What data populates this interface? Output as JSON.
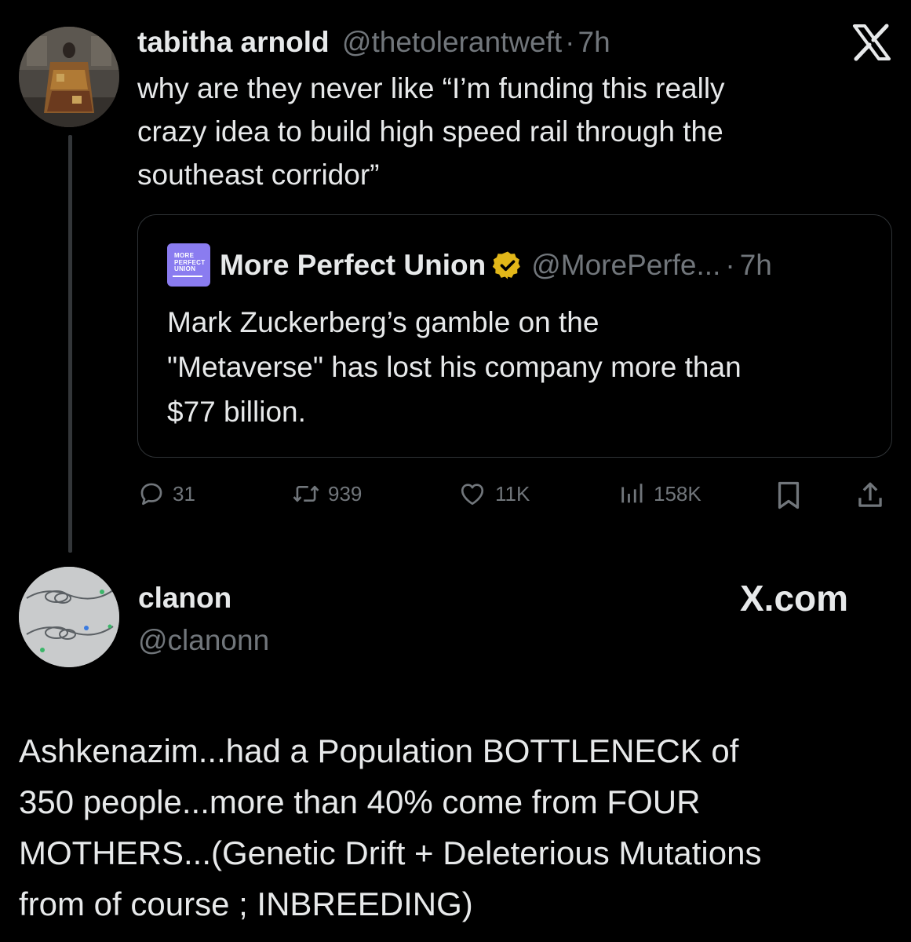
{
  "tweet1": {
    "display_name": "tabitha arnold",
    "handle": "@thetolerantweft",
    "separator": "·",
    "time": "7h",
    "text_lines": [
      "why are they never like “I’m funding this really",
      "crazy idea to build high speed rail through the",
      "southeast corridor”"
    ],
    "x_logo": "X",
    "quote": {
      "avatar_text_lines": [
        "MORE",
        "PERFECT",
        "UNION"
      ],
      "display_name": "More Perfect Union",
      "handle": "@MorePerfe...",
      "separator": "·",
      "time": "7h",
      "text_lines": [
        "Mark Zuckerberg’s gamble on the",
        "\"Metaverse\" has lost his company more than",
        "$77 billion."
      ]
    },
    "actions": {
      "replies": "31",
      "reposts": "939",
      "likes": "11K",
      "views": "158K"
    }
  },
  "tweet2": {
    "display_name": "clanon",
    "handle": "@clanonn",
    "brand": "X.com",
    "text_lines": [
      "Ashkenazim...had a Population BOTTLENECK of",
      "350 people...more than 40% come from FOUR",
      "MOTHERS...(Genetic Drift + Deleterious Mutations",
      "from of course ; INBREEDING)"
    ]
  },
  "colors": {
    "background": "#000000",
    "text": "#e7e9ea",
    "secondary": "#71767b",
    "border": "#2f3336",
    "verified_gold": "#e2b719",
    "mpu_purple": "#8a7cf0"
  }
}
